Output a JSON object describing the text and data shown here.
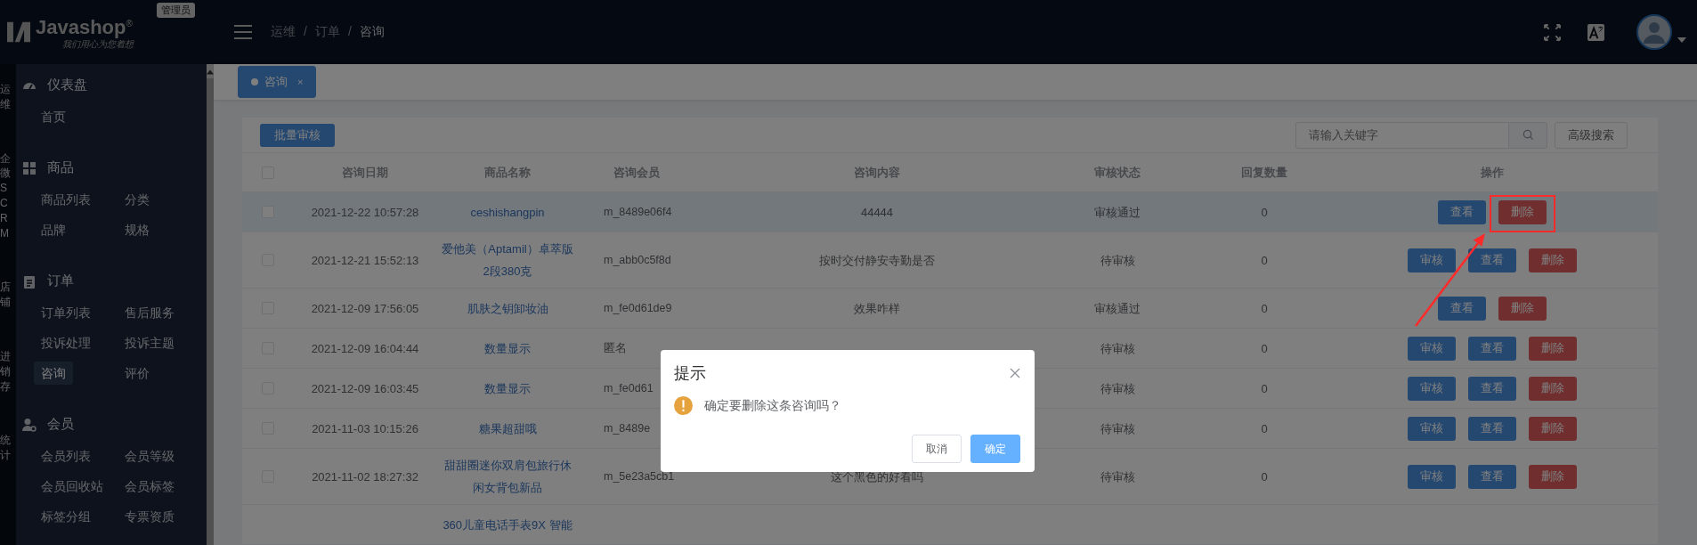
{
  "header": {
    "logo": {
      "name": "Javashop",
      "mark": "®",
      "slogan": "我们用心为您着想"
    },
    "role_badge": "管理员",
    "breadcrumb": [
      "运维",
      "订单",
      "咨询"
    ],
    "breadcrumb_separator": "/"
  },
  "rail": [
    "运维",
    "企微SCRM",
    "店铺",
    "进销存",
    "统计"
  ],
  "sidebar": {
    "groups": [
      {
        "title": "仪表盘",
        "kind": "dashboard",
        "items": [
          {
            "label": "首页",
            "selected": false
          }
        ]
      },
      {
        "title": "商品",
        "kind": "goods",
        "items": [
          {
            "label": "商品列表",
            "selected": false
          },
          {
            "label": "分类",
            "selected": false
          },
          {
            "label": "品牌",
            "selected": false
          },
          {
            "label": "规格",
            "selected": false
          }
        ]
      },
      {
        "title": "订单",
        "kind": "orders",
        "items": [
          {
            "label": "订单列表",
            "selected": false
          },
          {
            "label": "售后服务",
            "selected": false
          },
          {
            "label": "投诉处理",
            "selected": false
          },
          {
            "label": "投诉主题",
            "selected": false
          },
          {
            "label": "咨询",
            "selected": true
          },
          {
            "label": "评价",
            "selected": false
          }
        ]
      },
      {
        "title": "会员",
        "kind": "members",
        "items": [
          {
            "label": "会员列表",
            "selected": false
          },
          {
            "label": "会员等级",
            "selected": false
          },
          {
            "label": "会员回收站",
            "selected": false
          },
          {
            "label": "会员标签",
            "selected": false
          },
          {
            "label": "标签分组",
            "selected": false
          },
          {
            "label": "专票资质",
            "selected": false
          }
        ]
      }
    ]
  },
  "tabs": [
    {
      "label": "咨询",
      "selected": true,
      "close": "×"
    }
  ],
  "toolbar": {
    "batch_button": "批量审核",
    "search": {
      "placeholder": "请输入关键字"
    },
    "advanced_button": "高级搜索"
  },
  "table": {
    "all_checked": false,
    "columns": [
      "咨询日期",
      "商品名称",
      "咨询会员",
      "咨询内容",
      "审核状态",
      "回复数量",
      "操作"
    ],
    "rows": [
      {
        "checked": false,
        "selected": true,
        "date": "2021-12-22 10:57:28",
        "product": "ceshishangpin",
        "member": "m_8489e06f4",
        "content": "44444",
        "status": "审核通过",
        "replies": "0",
        "actions": [
          {
            "label": "查看",
            "kind": "view"
          },
          {
            "label": "删除",
            "kind": "delete"
          }
        ]
      },
      {
        "checked": false,
        "selected": false,
        "date": "2021-12-21 15:52:13",
        "product": "爱他美（Aptamil）卓萃版2段380克",
        "member": "m_abb0c5f8d",
        "content": "按时交付静安寺勤是否",
        "status": "待审核",
        "replies": "0",
        "actions": [
          {
            "label": "审核",
            "kind": "audit"
          },
          {
            "label": "查看",
            "kind": "view"
          },
          {
            "label": "删除",
            "kind": "delete"
          }
        ]
      },
      {
        "checked": false,
        "selected": false,
        "date": "2021-12-09 17:56:05",
        "product": "肌肤之钥卸妆油",
        "member": "m_fe0d61de9",
        "content": "效果咋样",
        "status": "审核通过",
        "replies": "0",
        "actions": [
          {
            "label": "查看",
            "kind": "view"
          },
          {
            "label": "删除",
            "kind": "delete"
          }
        ]
      },
      {
        "checked": false,
        "selected": false,
        "date": "2021-12-09 16:04:44",
        "product": "数量显示",
        "member": "匿名",
        "status": "待审核",
        "replies": "0",
        "actions": [
          {
            "label": "审核",
            "kind": "audit"
          },
          {
            "label": "查看",
            "kind": "view"
          },
          {
            "label": "删除",
            "kind": "delete"
          }
        ]
      },
      {
        "checked": false,
        "selected": false,
        "date": "2021-12-09 16:03:45",
        "product": "数量显示",
        "member": "m_fe0d61",
        "status": "待审核",
        "replies": "0",
        "actions": [
          {
            "label": "审核",
            "kind": "audit"
          },
          {
            "label": "查看",
            "kind": "view"
          },
          {
            "label": "删除",
            "kind": "delete"
          }
        ]
      },
      {
        "checked": false,
        "selected": false,
        "date": "2021-11-03 10:15:26",
        "product": "糖果超甜哦",
        "member": "m_8489e",
        "status": "待审核",
        "replies": "0",
        "actions": [
          {
            "label": "审核",
            "kind": "audit"
          },
          {
            "label": "查看",
            "kind": "view"
          },
          {
            "label": "删除",
            "kind": "delete"
          }
        ]
      },
      {
        "checked": false,
        "selected": false,
        "date": "2021-11-02 18:27:32",
        "product": "甜甜圈迷你双肩包旅行休闲女背包新品",
        "member": "m_5e23a5cb1",
        "content": "这个黑色的好看吗",
        "status": "待审核",
        "replies": "0",
        "actions": [
          {
            "label": "审核",
            "kind": "audit"
          },
          {
            "label": "查看",
            "kind": "view"
          },
          {
            "label": "删除",
            "kind": "delete"
          }
        ]
      },
      {
        "product": "360儿童电话手表9X 智能"
      }
    ]
  },
  "dialog": {
    "title": "提示",
    "message": "确定要删除这条咨询吗？",
    "buttons": [
      {
        "label": "取消",
        "kind": "default"
      },
      {
        "label": "确定",
        "kind": "primary"
      }
    ]
  }
}
